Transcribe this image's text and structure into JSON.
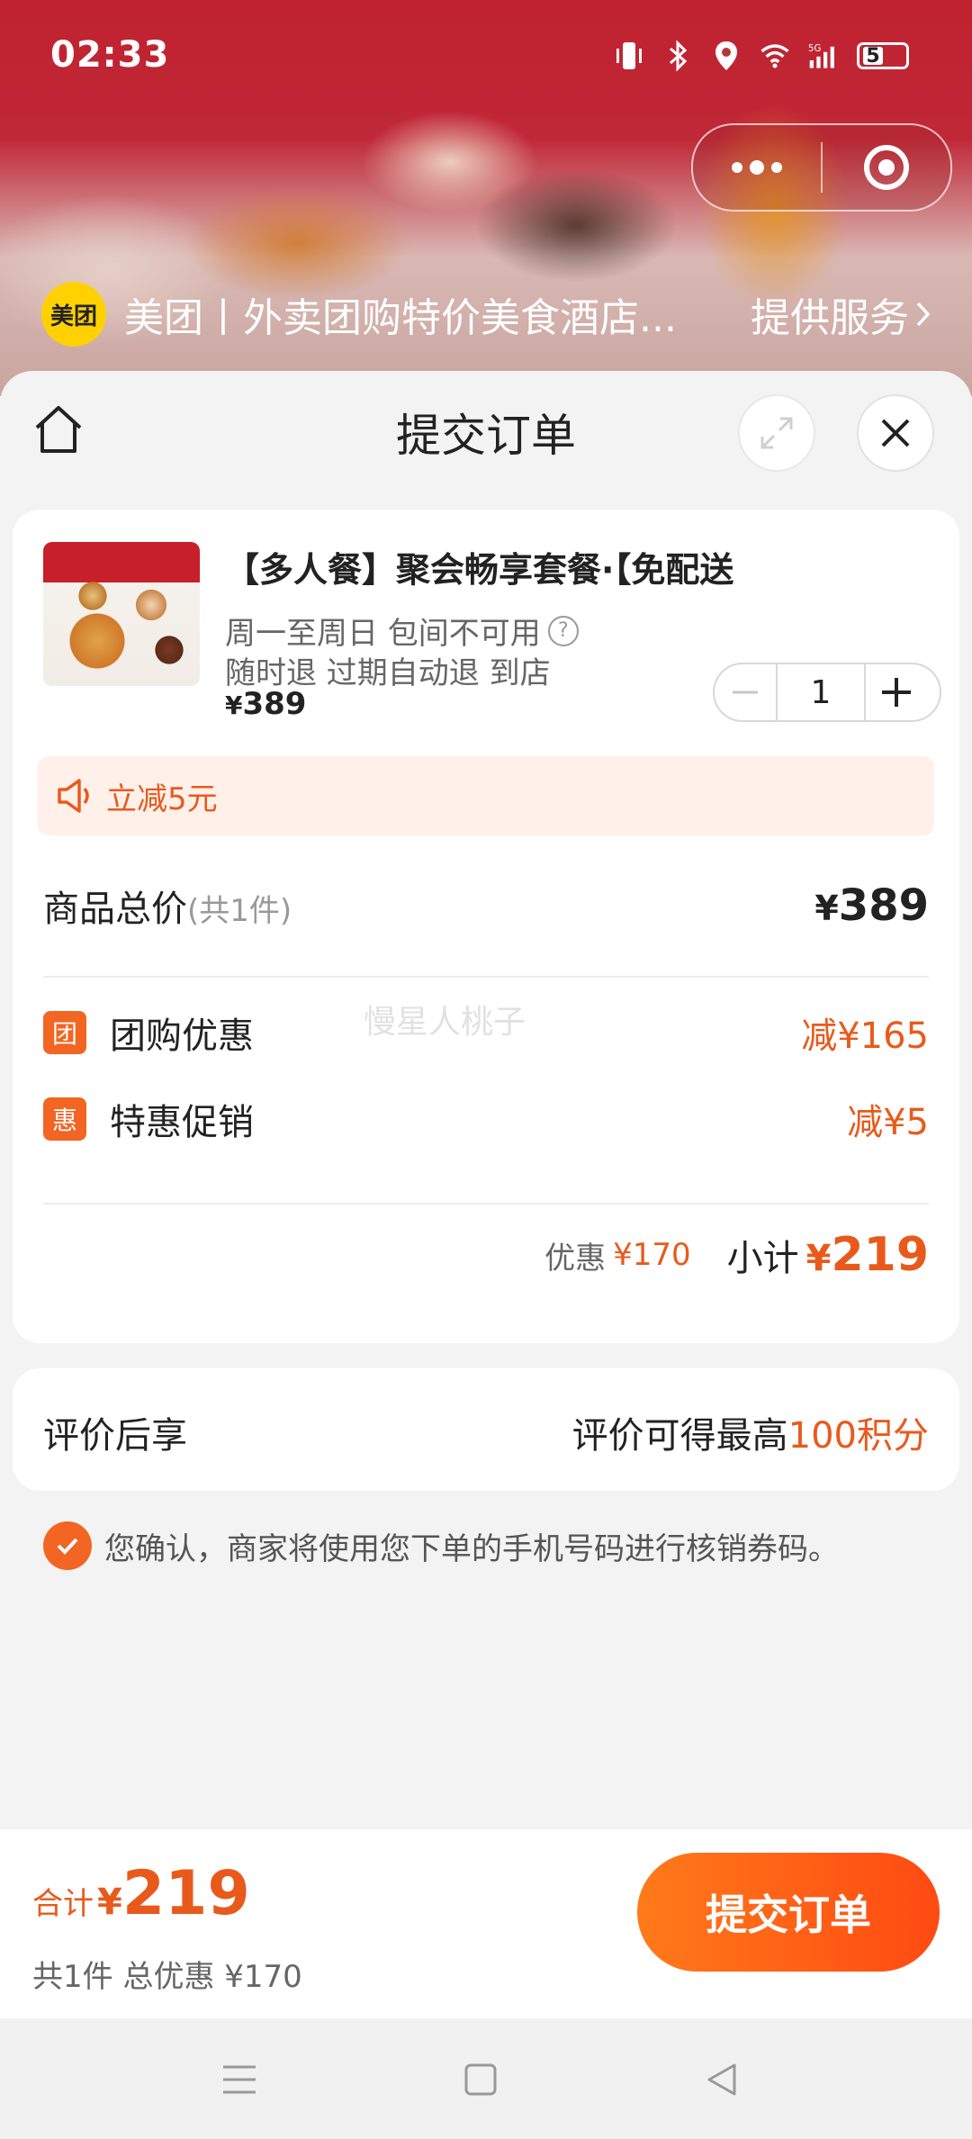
{
  "status_bar": {
    "time": "02:33",
    "battery": "5",
    "icons": [
      "vibrate-icon",
      "bluetooth-icon",
      "location-icon",
      "wifi-icon",
      "signal-5g-icon",
      "battery-icon"
    ]
  },
  "app_bar": {
    "logo_text": "美团",
    "app_name": "美团丨外卖团购特价美食酒店...",
    "service_link": "提供服务"
  },
  "sheet": {
    "title": "提交订单"
  },
  "product": {
    "title": "【多人餐】聚会畅享套餐·【免配送",
    "availability": "周一至周日 包间不可用",
    "refund": "随时退 过期自动退 到店",
    "currency": "¥",
    "price": "389",
    "quantity": "1"
  },
  "discount_banner": {
    "text": "立减5元"
  },
  "order_total": {
    "label": "商品总价",
    "count": "(共1件)",
    "currency": "¥",
    "value": "389"
  },
  "watermark": "慢星人桃子",
  "promotions": [
    {
      "badge": "团",
      "label": "团购优惠",
      "value": "减¥165"
    },
    {
      "badge": "惠",
      "label": "特惠促销",
      "value": "减¥5"
    }
  ],
  "subtotal": {
    "discount_label": "优惠",
    "discount_value": "¥170",
    "label": "小计",
    "currency": "¥",
    "value": "219"
  },
  "review": {
    "label": "评价后享",
    "text": "评价可得最高",
    "highlight": "100积分"
  },
  "confirm": {
    "text": "您确认，商家将使用您下单的手机号码进行核销券码。"
  },
  "bottom_bar": {
    "total_label": "合计",
    "currency": "¥",
    "total_value": "219",
    "summary": "共1件 总优惠 ¥170",
    "submit_label": "提交订单"
  },
  "colors": {
    "accent": "#e85a1c",
    "badge": "#f26522",
    "submit_start": "#ff7a1a",
    "submit_end": "#ff4a12",
    "banner_bg": "#fff0ea",
    "logo_yellow": "#ffd100"
  }
}
